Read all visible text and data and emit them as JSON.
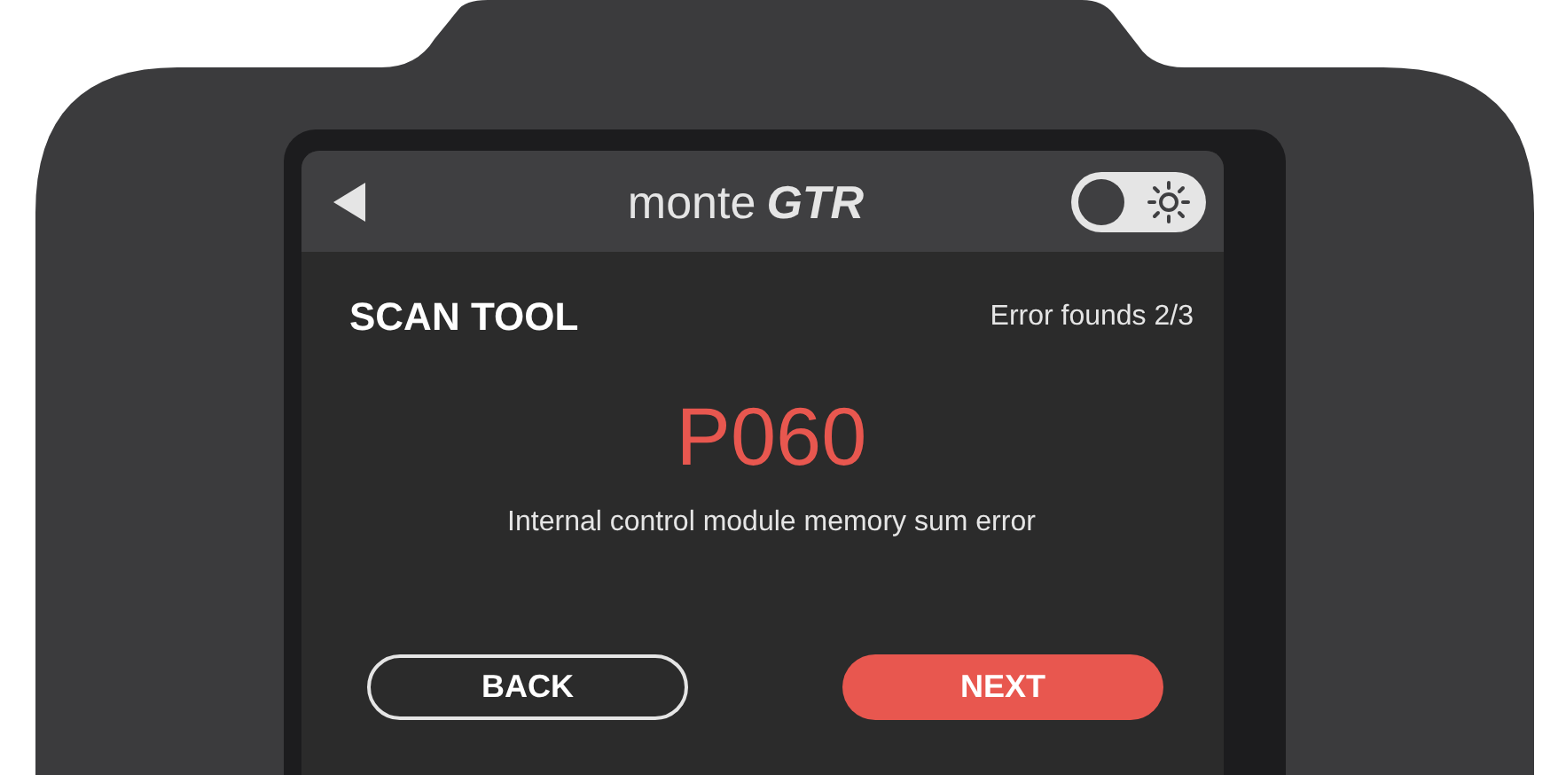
{
  "header": {
    "logo": {
      "brand": "monte",
      "model": "GTR"
    },
    "theme_toggle": {
      "on": false
    }
  },
  "title": "SCAN TOOL",
  "counter": "Error founds 2/3",
  "error": {
    "code": "P060",
    "description": "Internal control module memory sum error"
  },
  "buttons": [
    {
      "label": "BACK",
      "kind": "outline"
    },
    {
      "label": "NEXT",
      "kind": "filled"
    }
  ]
}
